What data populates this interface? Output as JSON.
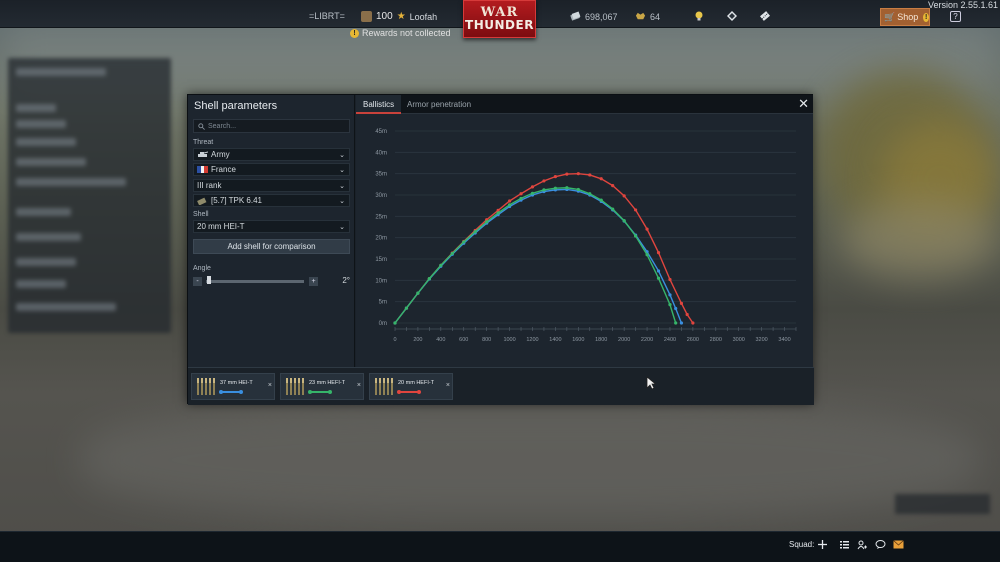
{
  "version": "Version 2.55.1.61",
  "topbar": {
    "clan_tag": "=LIBRT=",
    "level": "100",
    "username": "Loofah",
    "rewards_notice": "Rewards not collected",
    "logo_line1": "WAR",
    "logo_line2": "THUNDER",
    "silver_lions": "698,067",
    "golden_eagles": "64",
    "shop_label": "Shop",
    "shop_badge": "!",
    "help_label": "?"
  },
  "modal": {
    "title": "Shell parameters",
    "search_placeholder": "Search...",
    "threat_label": "Threat",
    "threat_value": "Army",
    "country_value": "France",
    "rank_value": "III rank",
    "vehicle_value": "[5.7] TPK 6.41",
    "shell_label": "Shell",
    "shell_value": "20 mm HEI-T",
    "add_shell_button": "Add shell for comparison",
    "angle_label": "Angle",
    "angle_value": "2°",
    "angle_minus": "-",
    "angle_plus": "+",
    "tabs": [
      {
        "label": "Ballistics",
        "active": true
      },
      {
        "label": "Armor penetration",
        "active": false
      }
    ],
    "close_label": "✕",
    "shells": [
      {
        "name": "37 mm HEI-T",
        "color": "#3a8fe0"
      },
      {
        "name": "23 mm HEFI-T",
        "color": "#36b56a"
      },
      {
        "name": "20 mm HEFI-T",
        "color": "#e0453e"
      }
    ],
    "remove_label": "×"
  },
  "chart_data": {
    "type": "line",
    "title": "",
    "xlabel": "",
    "ylabel": "",
    "x_ticks": [
      "0",
      "200",
      "400",
      "600",
      "800",
      "1000",
      "1200",
      "1400",
      "1600",
      "1800",
      "2000",
      "2200",
      "2400",
      "2600",
      "2800",
      "3000",
      "3200",
      "3400"
    ],
    "y_ticks": [
      "0m",
      "5m",
      "10m",
      "15m",
      "20m",
      "25m",
      "30m",
      "35m",
      "40m",
      "45m"
    ],
    "xlim": [
      0,
      3500
    ],
    "ylim": [
      0,
      45
    ],
    "grid": true,
    "series": [
      {
        "color": "#e0453e",
        "x": [
          0,
          100,
          200,
          300,
          400,
          500,
          600,
          700,
          800,
          900,
          1000,
          1100,
          1200,
          1300,
          1400,
          1500,
          1600,
          1700,
          1800,
          1900,
          2000,
          2100,
          2200,
          2300,
          2400,
          2500,
          2550,
          2600
        ],
        "y": [
          0,
          3.5,
          7.0,
          10.4,
          13.5,
          16.4,
          19.1,
          21.7,
          24.2,
          26.4,
          28.6,
          30.3,
          31.9,
          33.3,
          34.3,
          34.9,
          35.0,
          34.7,
          33.8,
          32.2,
          29.8,
          26.5,
          22.0,
          16.5,
          10.2,
          4.6,
          2.0,
          0
        ]
      },
      {
        "color": "#3a8fe0",
        "x": [
          0,
          100,
          200,
          300,
          400,
          500,
          600,
          700,
          800,
          900,
          1000,
          1100,
          1200,
          1300,
          1400,
          1500,
          1600,
          1700,
          1800,
          1900,
          2000,
          2100,
          2200,
          2300,
          2400,
          2450,
          2500
        ],
        "y": [
          0,
          3.5,
          7.0,
          10.3,
          13.3,
          16.1,
          18.7,
          21.1,
          23.4,
          25.4,
          27.3,
          28.8,
          30.0,
          30.8,
          31.2,
          31.3,
          30.9,
          30.0,
          28.5,
          26.5,
          23.9,
          20.6,
          16.7,
          12.2,
          6.6,
          3.4,
          0
        ]
      },
      {
        "color": "#36b56a",
        "x": [
          0,
          100,
          200,
          300,
          400,
          500,
          600,
          700,
          800,
          900,
          1000,
          1100,
          1200,
          1300,
          1400,
          1500,
          1600,
          1700,
          1800,
          1900,
          2000,
          2100,
          2200,
          2300,
          2400,
          2450
        ],
        "y": [
          0,
          3.5,
          7.0,
          10.4,
          13.5,
          16.3,
          19.0,
          21.4,
          23.7,
          25.8,
          27.7,
          29.2,
          30.4,
          31.2,
          31.6,
          31.7,
          31.3,
          30.3,
          28.8,
          26.7,
          24.0,
          20.4,
          16.0,
          10.5,
          4.3,
          0
        ]
      }
    ]
  },
  "footer": {
    "squad_label": "Squad:"
  }
}
